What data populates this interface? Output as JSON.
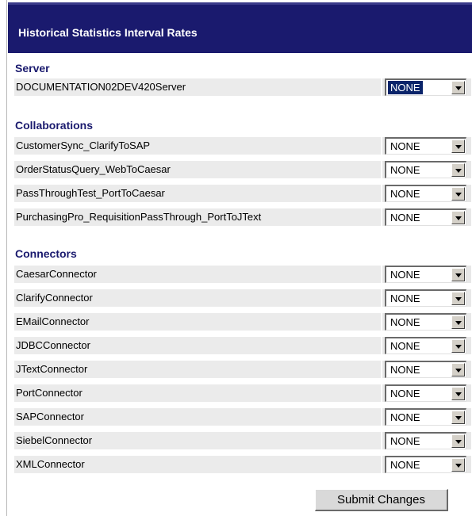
{
  "header": {
    "title": "Historical Statistics Interval Rates"
  },
  "sections": {
    "server": {
      "title": "Server"
    },
    "collaborations": {
      "title": "Collaborations"
    },
    "connectors": {
      "title": "Connectors"
    }
  },
  "server_rows": [
    {
      "name": "DOCUMENTATION02DEV420Server",
      "rate": "NONE"
    }
  ],
  "collaboration_rows": [
    {
      "name": "CustomerSync_ClarifyToSAP",
      "rate": "NONE"
    },
    {
      "name": "OrderStatusQuery_WebToCaesar",
      "rate": "NONE"
    },
    {
      "name": "PassThroughTest_PortToCaesar",
      "rate": "NONE"
    },
    {
      "name": "PurchasingPro_RequisitionPassThrough_PortToJText",
      "rate": "NONE"
    }
  ],
  "connector_rows": [
    {
      "name": "CaesarConnector",
      "rate": "NONE"
    },
    {
      "name": "ClarifyConnector",
      "rate": "NONE"
    },
    {
      "name": "EMailConnector",
      "rate": "NONE"
    },
    {
      "name": "JDBCConnector",
      "rate": "NONE"
    },
    {
      "name": "JTextConnector",
      "rate": "NONE"
    },
    {
      "name": "PortConnector",
      "rate": "NONE"
    },
    {
      "name": "SAPConnector",
      "rate": "NONE"
    },
    {
      "name": "SiebelConnector",
      "rate": "NONE"
    },
    {
      "name": "XMLConnector",
      "rate": "NONE"
    }
  ],
  "submit_label": "Submit Changes",
  "colors": {
    "header_bg": "#1a1a6e",
    "section_title": "#1a1a6e",
    "row_bg": "#ebebeb"
  }
}
